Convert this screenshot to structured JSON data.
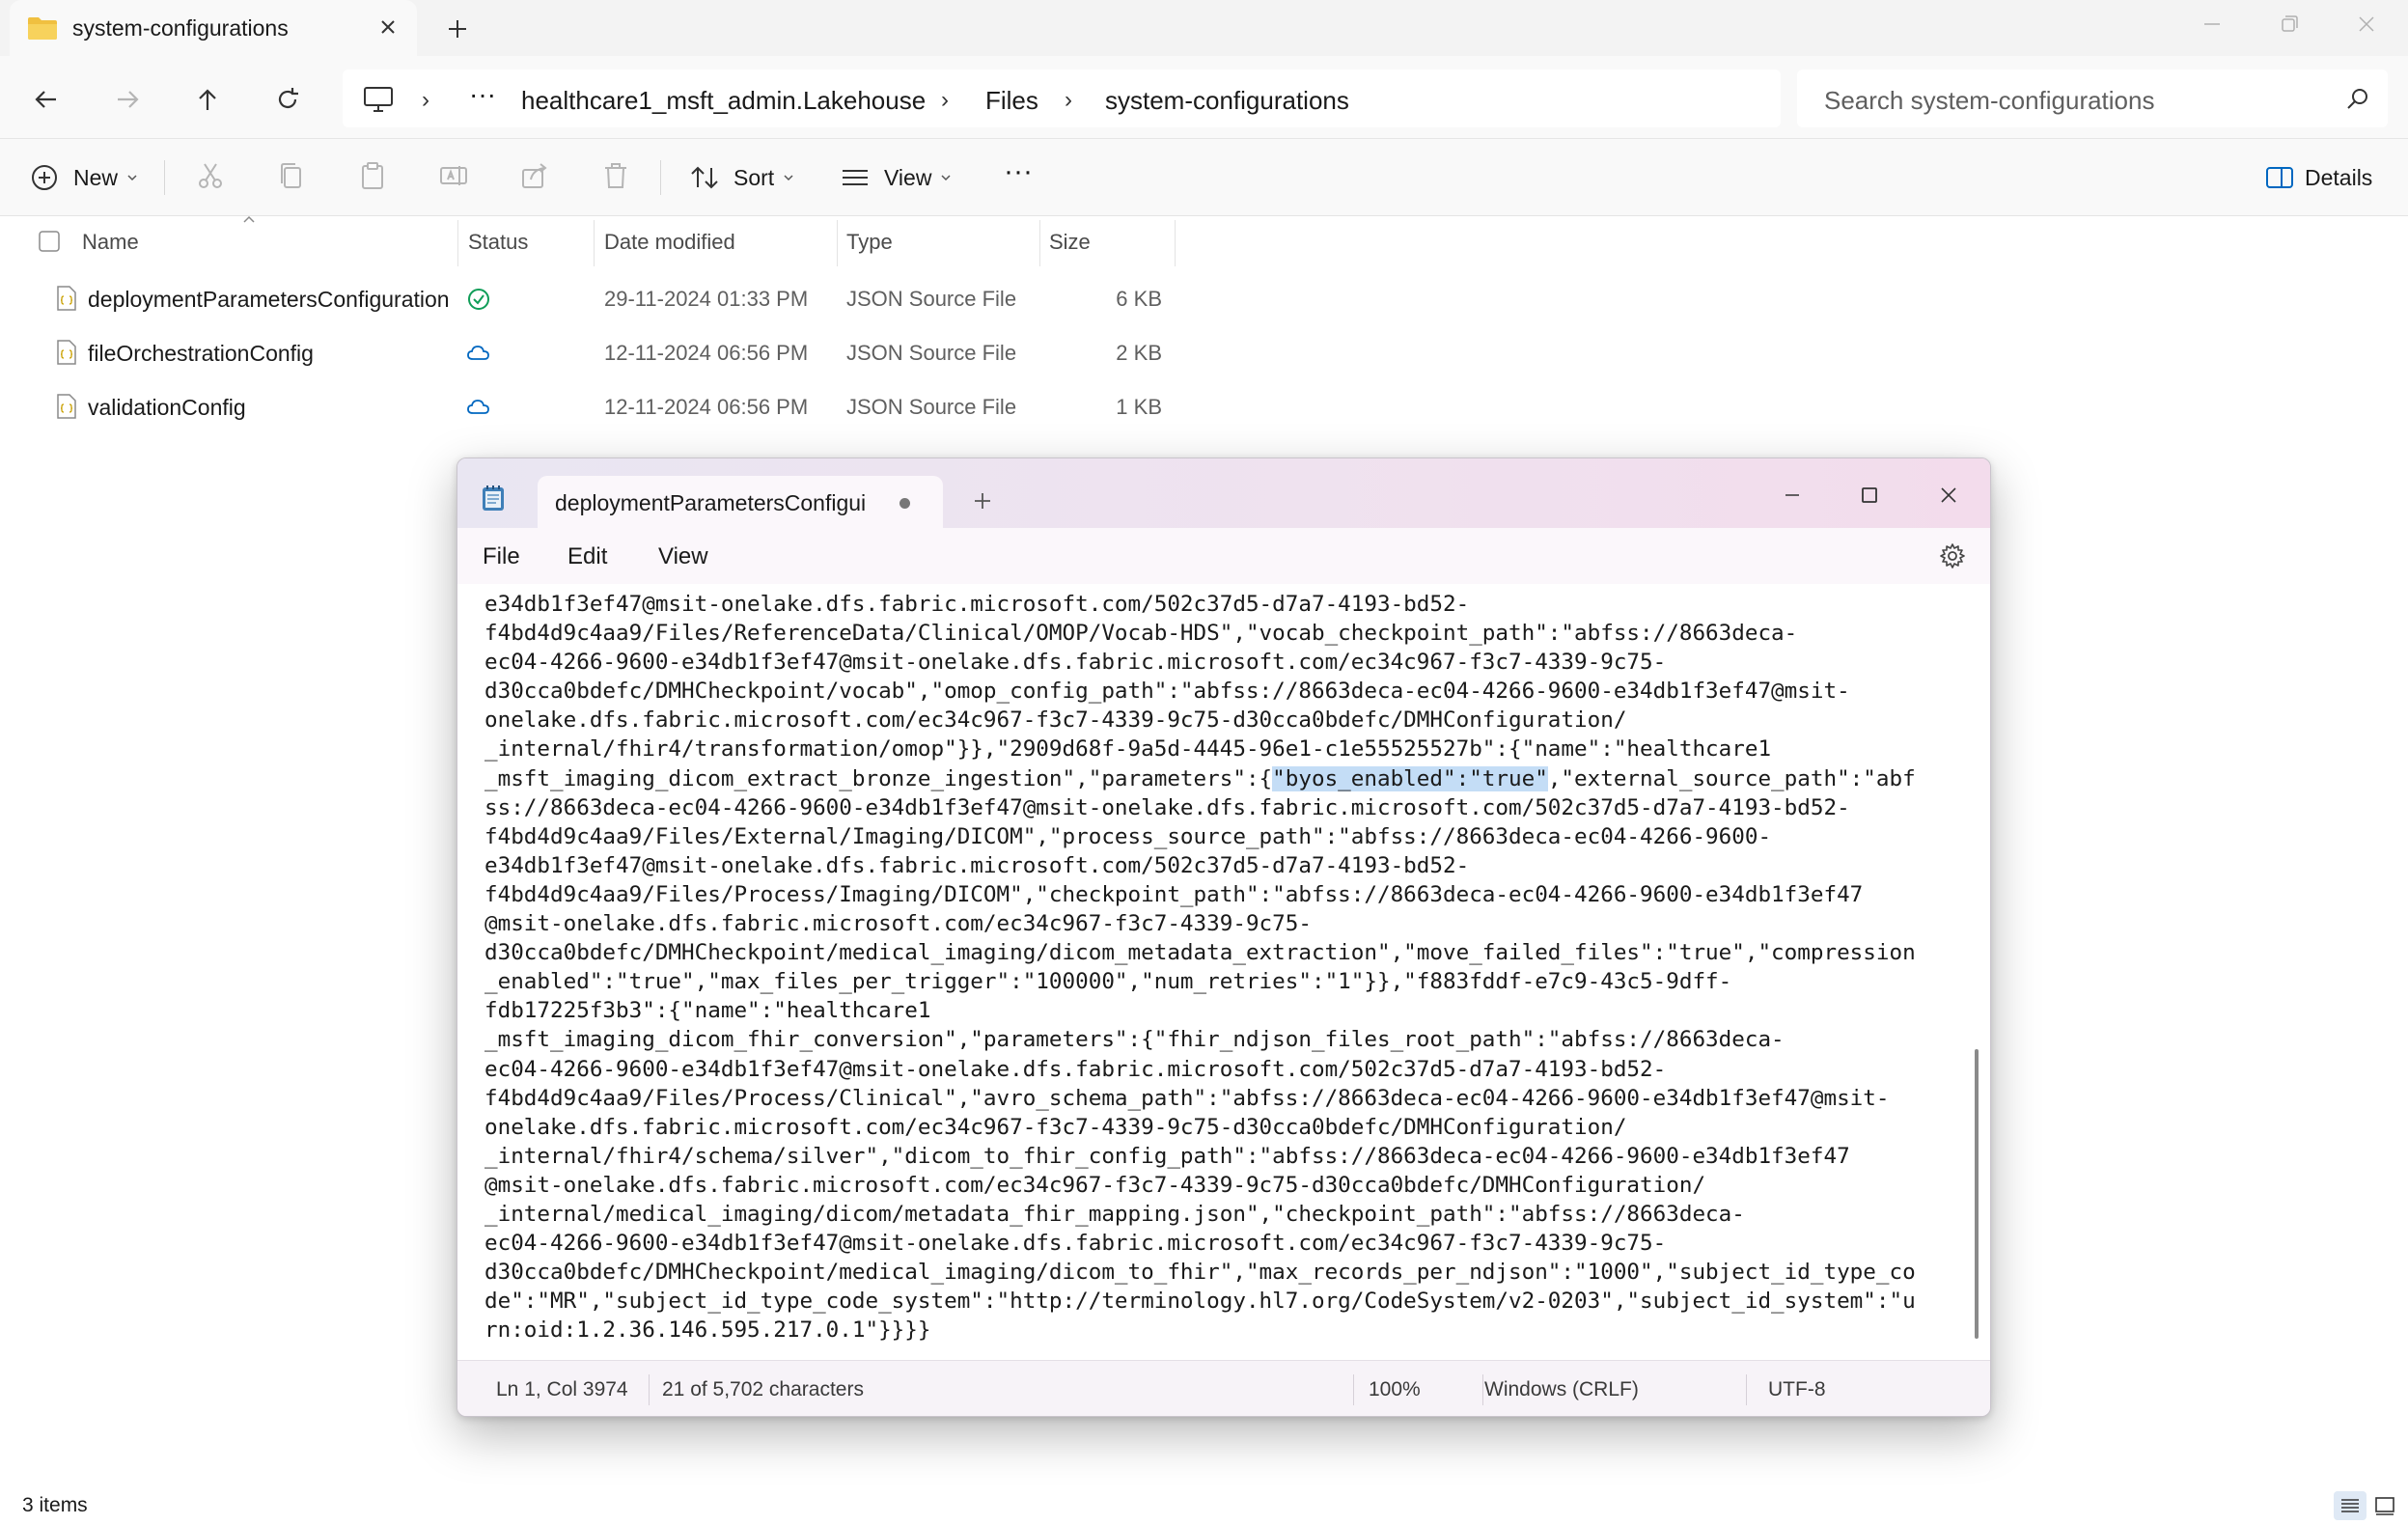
{
  "explorer": {
    "tab_title": "system-configurations",
    "breadcrumb": [
      "healthcare1_msft_admin.Lakehouse",
      "Files",
      "system-configurations"
    ],
    "breadcrumb_overflow": "···",
    "search_placeholder": "Search system-configurations",
    "toolbar": {
      "new_label": "New",
      "sort_label": "Sort",
      "view_label": "View",
      "more_label": "···",
      "details_label": "Details"
    },
    "columns": {
      "name": "Name",
      "status": "Status",
      "date_modified": "Date modified",
      "type": "Type",
      "size": "Size"
    },
    "files": [
      {
        "name": "deploymentParametersConfiguration",
        "status": "synced-check-icon",
        "date": "29-11-2024 01:33 PM",
        "type": "JSON Source File",
        "size": "6 KB"
      },
      {
        "name": "fileOrchestrationConfig",
        "status": "cloud-icon",
        "date": "12-11-2024 06:56 PM",
        "type": "JSON Source File",
        "size": "2 KB"
      },
      {
        "name": "validationConfig",
        "status": "cloud-icon",
        "date": "12-11-2024 06:56 PM",
        "type": "JSON Source File",
        "size": "1 KB"
      }
    ],
    "item_count": "3 items",
    "colors": {
      "accent": "#0067c0",
      "synced": "#0f9d58",
      "cloud": "#0067c0",
      "folder": "#f0c040"
    }
  },
  "notepad": {
    "tab_title": "deploymentParametersConfigui",
    "menu": {
      "file": "File",
      "edit": "Edit",
      "view": "View"
    },
    "content_lines": [
      "e34db1f3ef47@msit-onelake.dfs.fabric.microsoft.com/502c37d5-d7a7-4193-bd52-",
      "f4bd4d9c4aa9/Files/ReferenceData/Clinical/OMOP/Vocab-HDS\",\"vocab_checkpoint_path\":\"abfss://8663deca-",
      "ec04-4266-9600-e34db1f3ef47@msit-onelake.dfs.fabric.microsoft.com/ec34c967-f3c7-4339-9c75-",
      "d30cca0bdefc/DMHCheckpoint/vocab\",\"omop_config_path\":\"abfss://8663deca-ec04-4266-9600-e34db1f3ef47@msit-",
      "onelake.dfs.fabric.microsoft.com/ec34c967-f3c7-4339-9c75-d30cca0bdefc/DMHConfiguration/",
      "_internal/fhir4/transformation/omop\"}},\"2909d68f-9a5d-4445-96e1-c1e55525527b\":{\"name\":\"healthcare1",
      "_msft_imaging_dicom_extract_bronze_ingestion\",\"parameters\":{",
      "ss://8663deca-ec04-4266-9600-e34db1f3ef47@msit-onelake.dfs.fabric.microsoft.com/502c37d5-d7a7-4193-bd52-",
      "f4bd4d9c4aa9/Files/External/Imaging/DICOM\",\"process_source_path\":\"abfss://8663deca-ec04-4266-9600-",
      "e34db1f3ef47@msit-onelake.dfs.fabric.microsoft.com/502c37d5-d7a7-4193-bd52-",
      "f4bd4d9c4aa9/Files/Process/Imaging/DICOM\",\"checkpoint_path\":\"abfss://8663deca-ec04-4266-9600-e34db1f3ef47",
      "@msit-onelake.dfs.fabric.microsoft.com/ec34c967-f3c7-4339-9c75-",
      "d30cca0bdefc/DMHCheckpoint/medical_imaging/dicom_metadata_extraction\",\"move_failed_files\":\"true\",\"compression",
      "_enabled\":\"true\",\"max_files_per_trigger\":\"100000\",\"num_retries\":\"1\"}},\"f883fddf-e7c9-43c5-9dff-",
      "fdb17225f3b3\":{\"name\":\"healthcare1",
      "_msft_imaging_dicom_fhir_conversion\",\"parameters\":{\"fhir_ndjson_files_root_path\":\"abfss://8663deca-",
      "ec04-4266-9600-e34db1f3ef47@msit-onelake.dfs.fabric.microsoft.com/502c37d5-d7a7-4193-bd52-",
      "f4bd4d9c4aa9/Files/Process/Clinical\",\"avro_schema_path\":\"abfss://8663deca-ec04-4266-9600-e34db1f3ef47@msit-",
      "onelake.dfs.fabric.microsoft.com/ec34c967-f3c7-4339-9c75-d30cca0bdefc/DMHConfiguration/",
      "_internal/fhir4/schema/silver\",\"dicom_to_fhir_config_path\":\"abfss://8663deca-ec04-4266-9600-e34db1f3ef47",
      "@msit-onelake.dfs.fabric.microsoft.com/ec34c967-f3c7-4339-9c75-d30cca0bdefc/DMHConfiguration/",
      "_internal/medical_imaging/dicom/metadata_fhir_mapping.json\",\"checkpoint_path\":\"abfss://8663deca-",
      "ec04-4266-9600-e34db1f3ef47@msit-onelake.dfs.fabric.microsoft.com/ec34c967-f3c7-4339-9c75-",
      "d30cca0bdefc/DMHCheckpoint/medical_imaging/dicom_to_fhir\",\"max_records_per_ndjson\":\"1000\",\"subject_id_type_co",
      "de\":\"MR\",\"subject_id_type_code_system\":\"http://terminology.hl7.org/CodeSystem/v2-0203\",\"subject_id_system\":\"u",
      "rn:oid:1.2.36.146.595.217.0.1\"}}}}"
    ],
    "selected_text": "\"byos_enabled\":\"true\"",
    "after_selection": ",\"external_source_path\":\"abf",
    "status": {
      "position": "Ln 1, Col 3974",
      "selection": "21 of 5,702 characters",
      "zoom": "100%",
      "line_ending": "Windows (CRLF)",
      "encoding": "UTF-8"
    }
  }
}
